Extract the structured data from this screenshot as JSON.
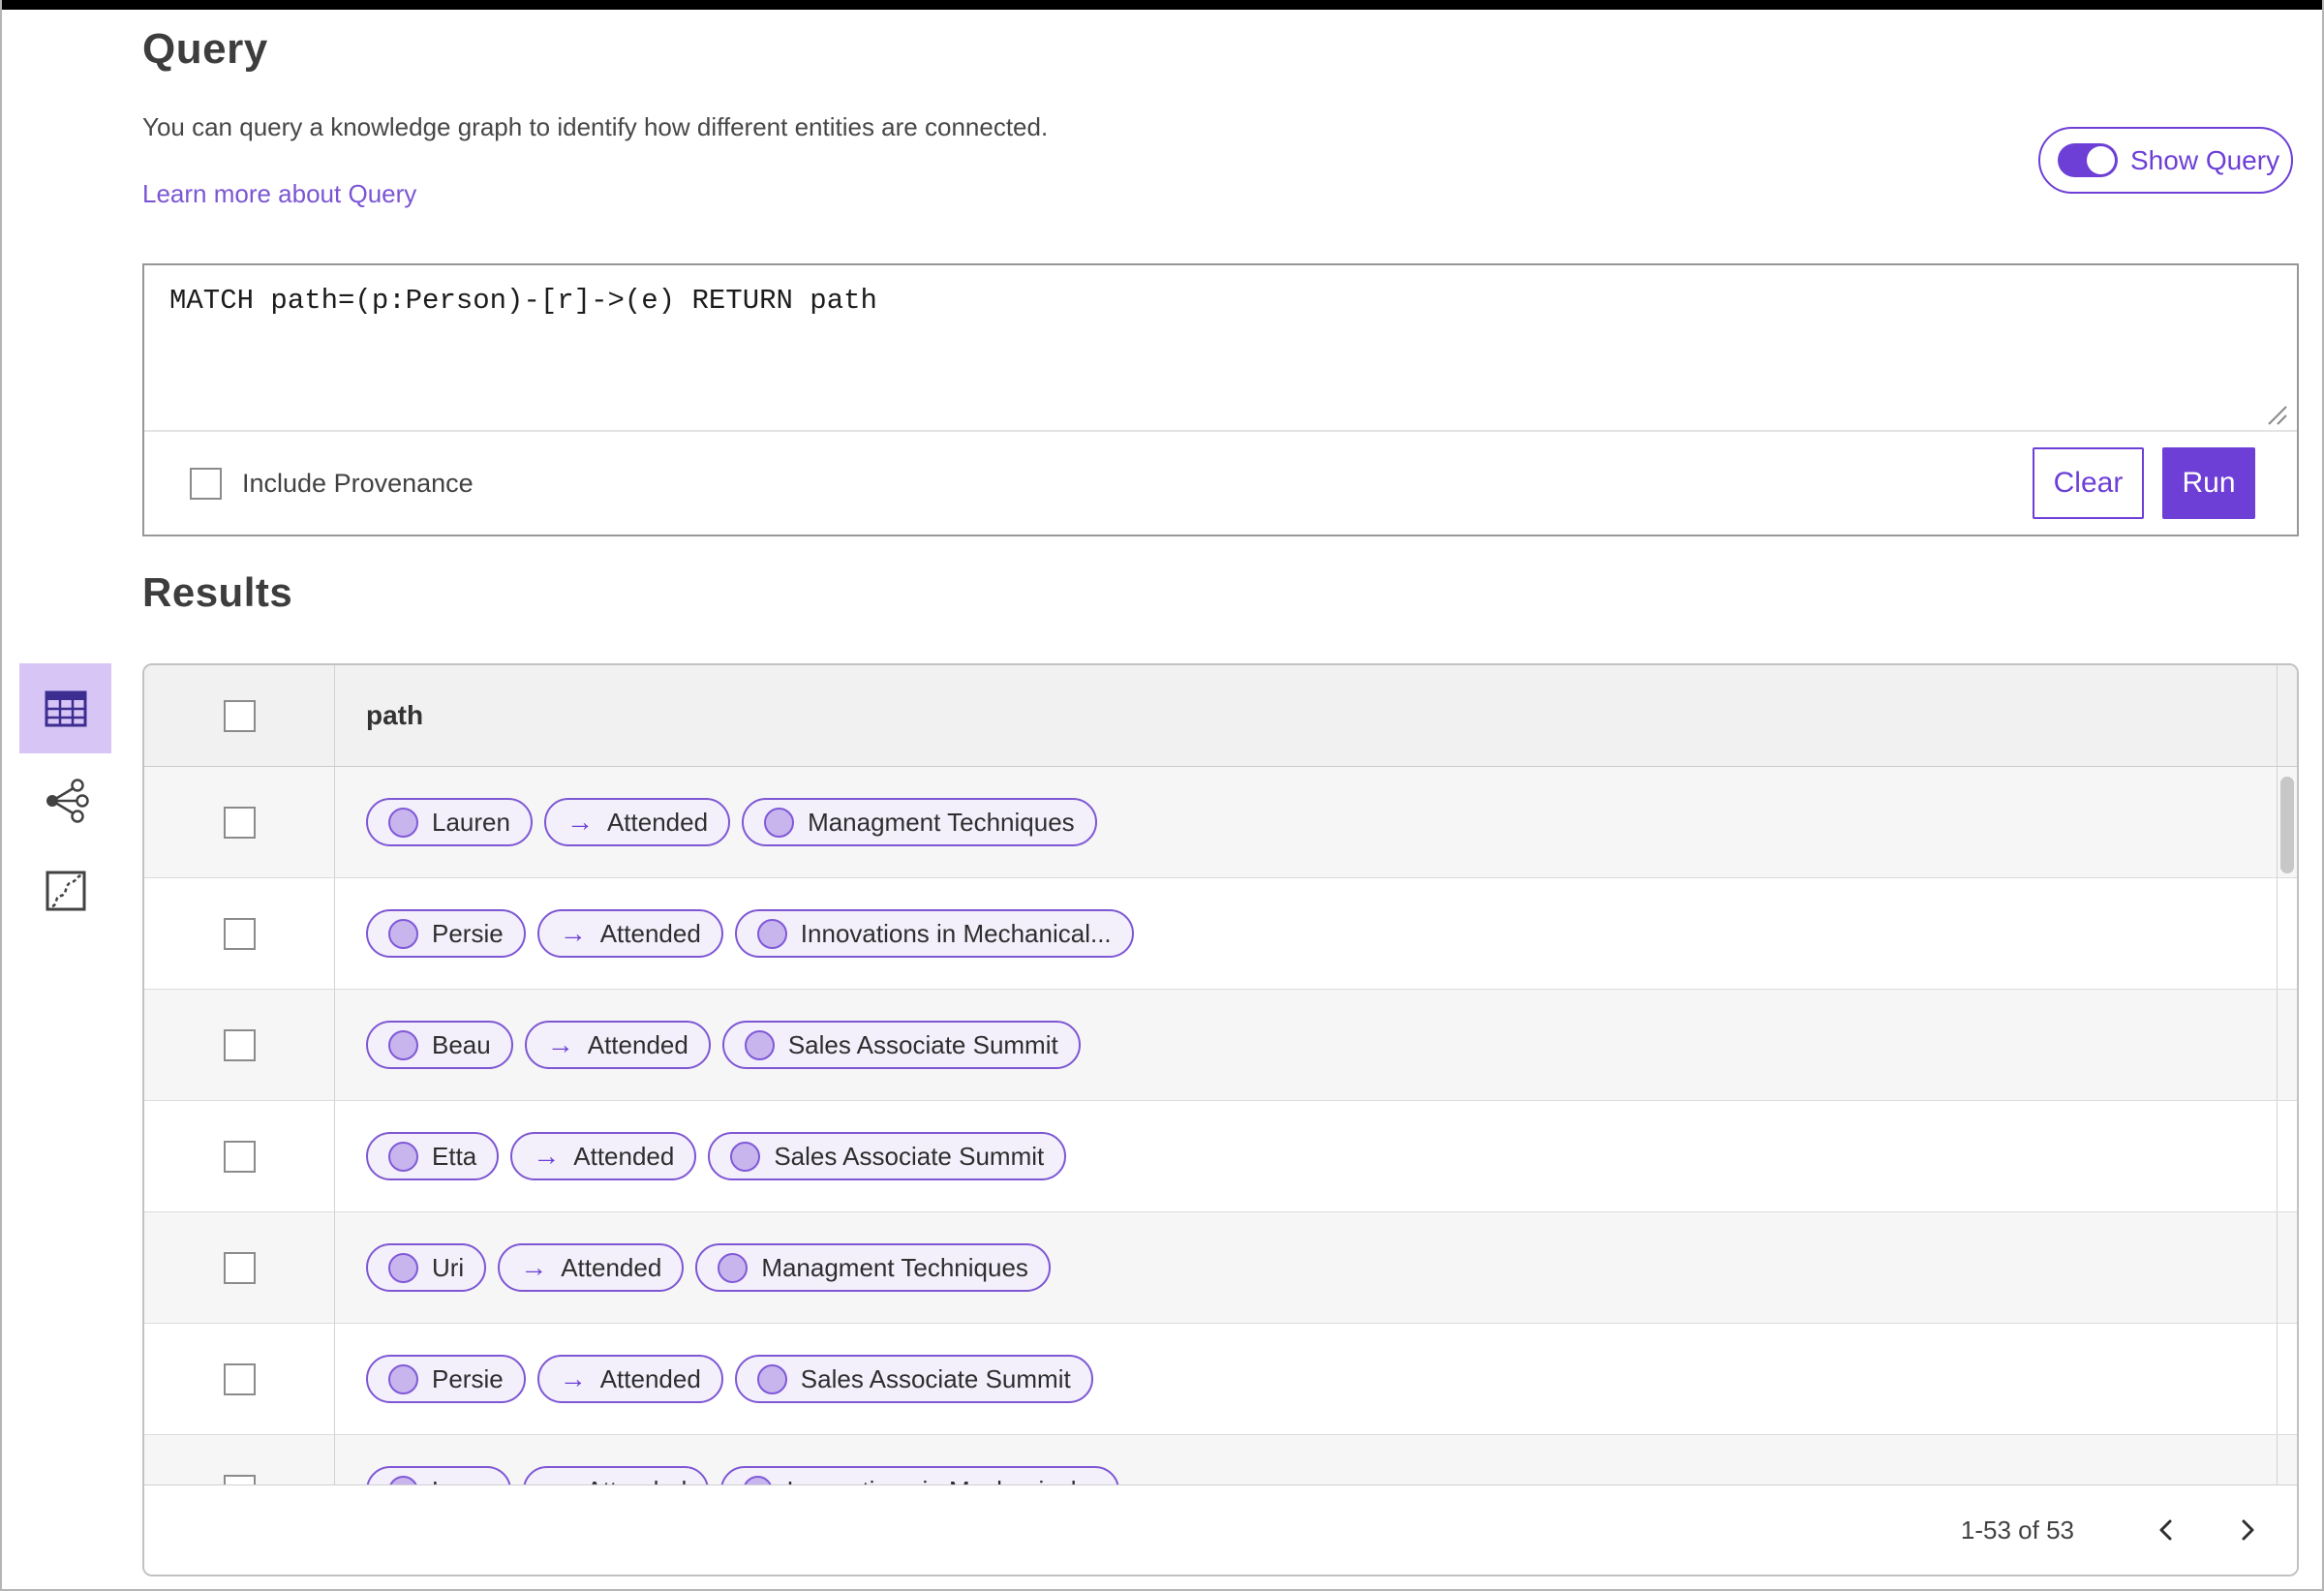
{
  "header": {
    "title": "Query",
    "description": "You can query a knowledge graph to identify how different entities are connected.",
    "learn_more_label": "Learn more about Query",
    "show_query_label": "Show Query",
    "show_query_on": true
  },
  "query_editor": {
    "text": "MATCH path=(p:Person)-[r]->(e) RETURN path",
    "include_provenance_label": "Include Provenance",
    "include_provenance_checked": false,
    "clear_label": "Clear",
    "run_label": "Run"
  },
  "results": {
    "title": "Results",
    "views": [
      {
        "name": "table-view",
        "selected": true
      },
      {
        "name": "graph-view",
        "selected": false
      },
      {
        "name": "chart-view",
        "selected": false
      }
    ],
    "column_header": "path",
    "rows": [
      {
        "source": "Lauren",
        "relation": "Attended",
        "target": "Managment Techniques"
      },
      {
        "source": "Persie",
        "relation": "Attended",
        "target": "Innovations in Mechanical..."
      },
      {
        "source": "Beau",
        "relation": "Attended",
        "target": "Sales Associate Summit"
      },
      {
        "source": "Etta",
        "relation": "Attended",
        "target": "Sales Associate Summit"
      },
      {
        "source": "Uri",
        "relation": "Attended",
        "target": "Managment Techniques"
      },
      {
        "source": "Persie",
        "relation": "Attended",
        "target": "Sales Associate Summit"
      },
      {
        "source": "Larry",
        "relation": "Attended",
        "target": "Innovations in Mechanical..."
      }
    ],
    "pagination": {
      "range_label": "1-53 of 53"
    }
  },
  "icons": {
    "edge_arrow": "→"
  },
  "colors": {
    "accent": "#6d3fd6",
    "link": "#7a55d4",
    "pill_border": "#7e57d4",
    "pill_bg": "#f3f0fb",
    "node_fill": "#c9b5ee",
    "selected_view_bg": "#d7c5f5",
    "header_row_bg": "#f1f1f1",
    "stripe_row_bg": "#f6f6f6"
  }
}
